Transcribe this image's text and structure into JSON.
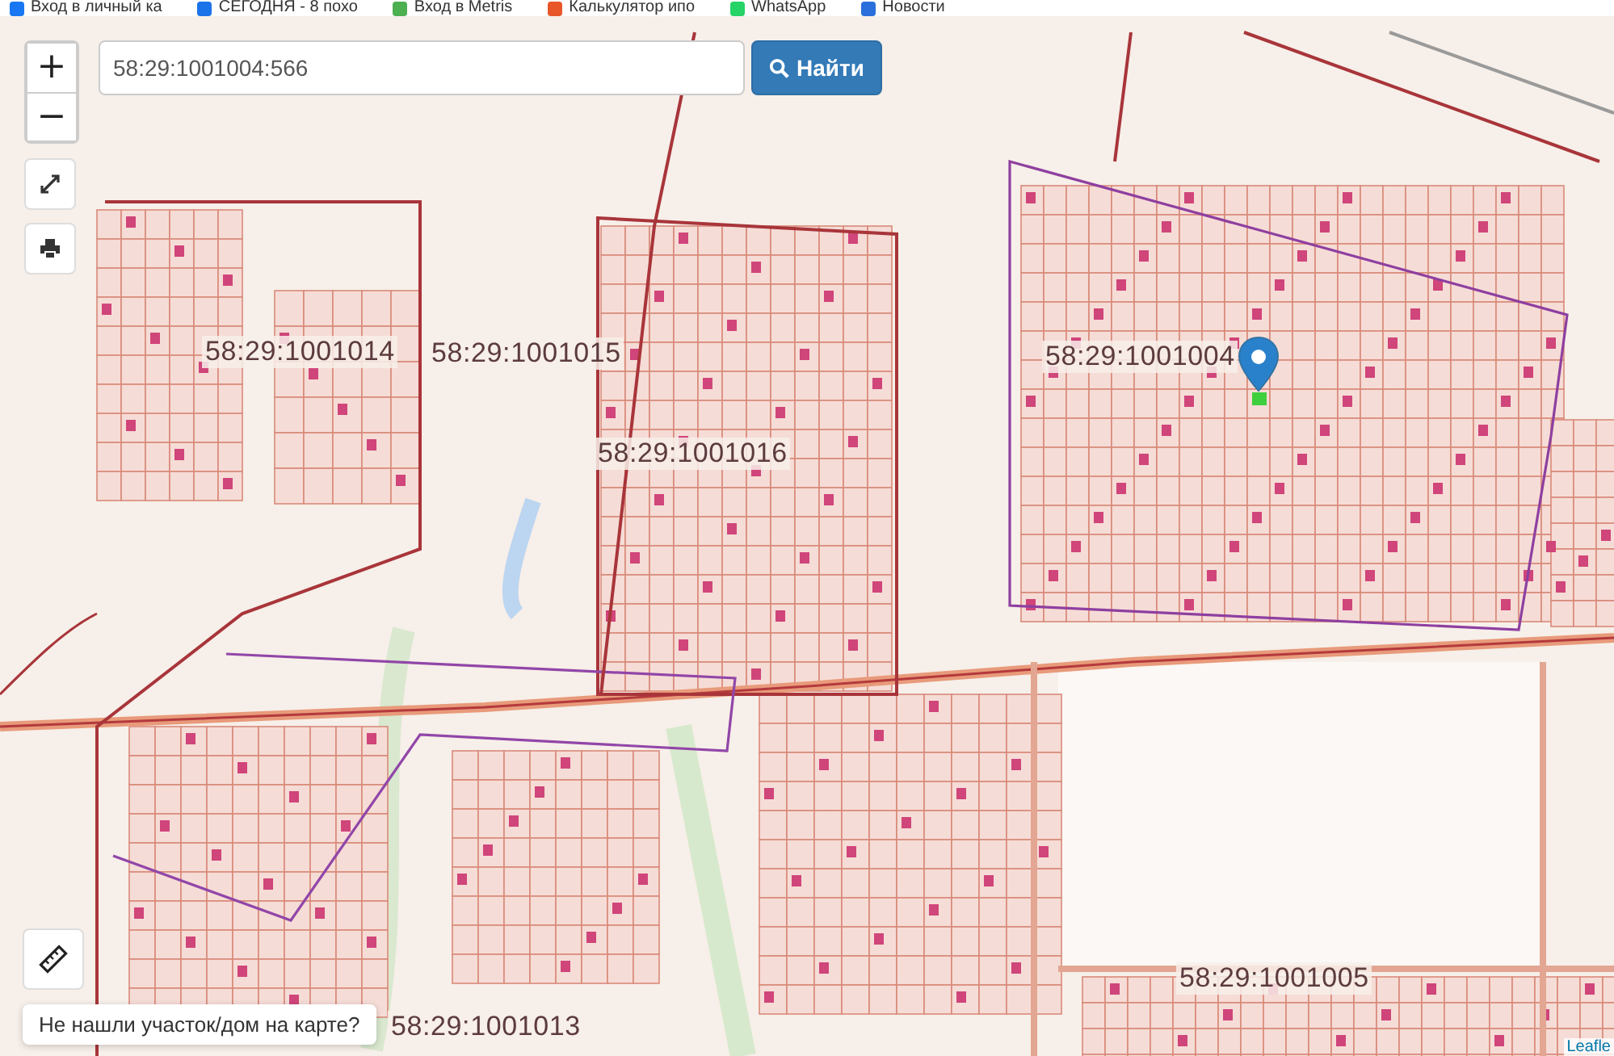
{
  "bookmarks": [
    {
      "label": "Вход в личный ка"
    },
    {
      "label": "СЕГОДНЯ - 8 похо"
    },
    {
      "label": "Вход в Metris"
    },
    {
      "label": "Калькулятор ипо"
    },
    {
      "label": "WhatsApp"
    },
    {
      "label": "Новости"
    }
  ],
  "zoom_controls": {
    "zoom_in": "+",
    "zoom_out": "−"
  },
  "search": {
    "value": "58:29:1001004:566",
    "button": "Найти"
  },
  "map": {
    "parcel_labels": [
      {
        "text": "58:29:1001014"
      },
      {
        "text": "58:29:1001015"
      },
      {
        "text": "58:29:1001016"
      },
      {
        "text": "58:29:1001004"
      },
      {
        "text": "58:29:1001005"
      },
      {
        "text": "58:29:1001013"
      }
    ]
  },
  "help_button": "Не нашли участок/дом на карте?",
  "attribution": "Leafle"
}
